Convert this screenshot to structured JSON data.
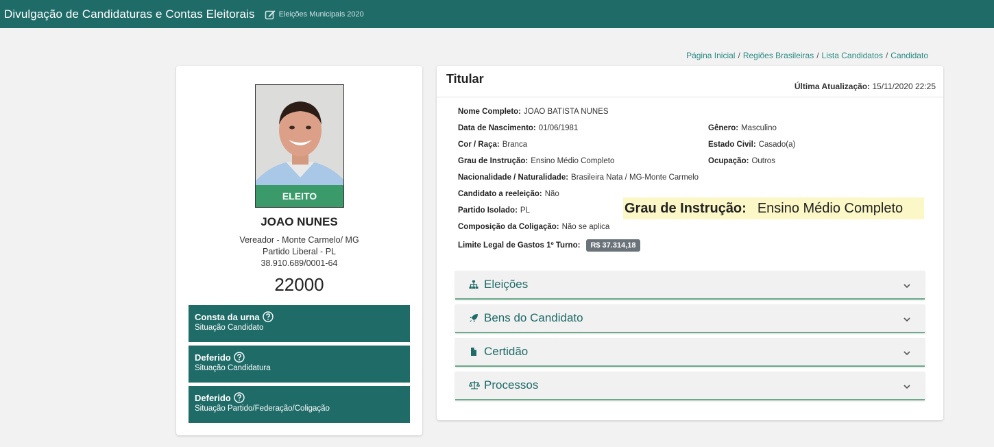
{
  "header": {
    "title": "Divulgação de Candidaturas e Contas Eleitorais",
    "subtitle": "Eleições Municipais 2020",
    "bg_color": "#1f6b68"
  },
  "breadcrumb": [
    "Página Inicial",
    "Regiões Brasileiras",
    "Lista Candidatos",
    "Candidato"
  ],
  "candidate": {
    "badge": "ELEITO",
    "name": "JOAO NUNES",
    "role": "Vereador - Monte Carmelo/ MG",
    "party": "Partido Liberal - PL",
    "cnpj": "38.910.689/0001-64",
    "number": "22000"
  },
  "status": [
    {
      "title": "Consta da urna",
      "subtitle": "Situação Candidato"
    },
    {
      "title": "Deferido",
      "subtitle": "Situação Candidatura"
    },
    {
      "title": "Deferido",
      "subtitle": "Situação Partido/Federação/Coligação"
    }
  ],
  "details": {
    "title": "Titular",
    "update_label": "Última Atualização:",
    "update_value": "15/11/2020 22:25",
    "fields": {
      "nome": {
        "label": "Nome Completo:",
        "value": "JOAO BATISTA NUNES"
      },
      "nascimento": {
        "label": "Data de Nascimento:",
        "value": "01/06/1981"
      },
      "genero": {
        "label": "Gênero:",
        "value": "Masculino"
      },
      "cor": {
        "label": "Cor / Raça:",
        "value": "Branca"
      },
      "estado_civil": {
        "label": "Estado Civil:",
        "value": "Casado(a)"
      },
      "instrucao": {
        "label": "Grau de Instrução:",
        "value": "Ensino Médio Completo"
      },
      "ocupacao": {
        "label": "Ocupação:",
        "value": "Outros"
      },
      "nacionalidade": {
        "label": "Nacionalidade / Naturalidade:",
        "value": "Brasileira Nata / MG-Monte Carmelo"
      },
      "reeleicao": {
        "label": "Candidato a reeleição:",
        "value": "Não"
      },
      "partido": {
        "label": "Partido Isolado:",
        "value": "PL"
      },
      "coligacao": {
        "label": "Composição da Coligação:",
        "value": "Não se aplica"
      },
      "limite": {
        "label": "Limite Legal de Gastos 1º Turno:",
        "value": "R$ 37.314,18"
      }
    },
    "highlight": {
      "label": "Grau de Instrução:",
      "value": "Ensino Médio Completo"
    }
  },
  "accordions": [
    {
      "label": "Eleições",
      "icon": "sitemap-icon"
    },
    {
      "label": "Bens do Candidato",
      "icon": "rocket-icon"
    },
    {
      "label": "Certidão",
      "icon": "file-icon"
    },
    {
      "label": "Processos",
      "icon": "balance-scale-icon"
    }
  ]
}
